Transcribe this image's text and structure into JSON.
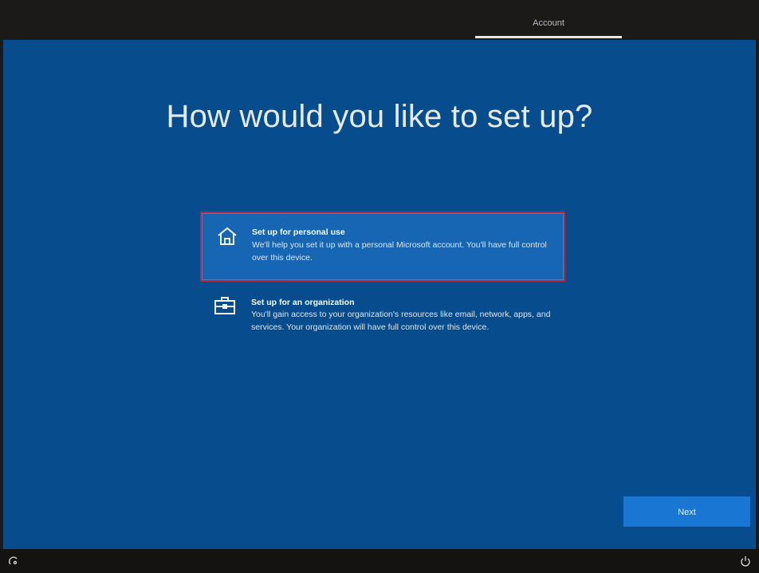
{
  "header": {
    "active_tab": "Account"
  },
  "page": {
    "title": "How would you like to set up?"
  },
  "options": [
    {
      "title": "Set up for personal use",
      "description": "We'll help you set it up with a personal Microsoft account. You'll have full control over this device.",
      "icon": "home-icon",
      "selected": true
    },
    {
      "title": "Set up for an organization",
      "description": "You'll gain access to your organization's resources like email, network, apps, and services. Your organization will have full control over this device.",
      "icon": "briefcase-icon",
      "selected": false
    }
  ],
  "footer": {
    "next_label": "Next",
    "left_icon": "ease-of-access-icon",
    "right_icon": "power-icon"
  },
  "colors": {
    "background": "#074d8d",
    "selected_option": "#1766b3",
    "selected_border": "#b02a44",
    "button": "#1976d2",
    "topbar": "#1c1a18"
  }
}
